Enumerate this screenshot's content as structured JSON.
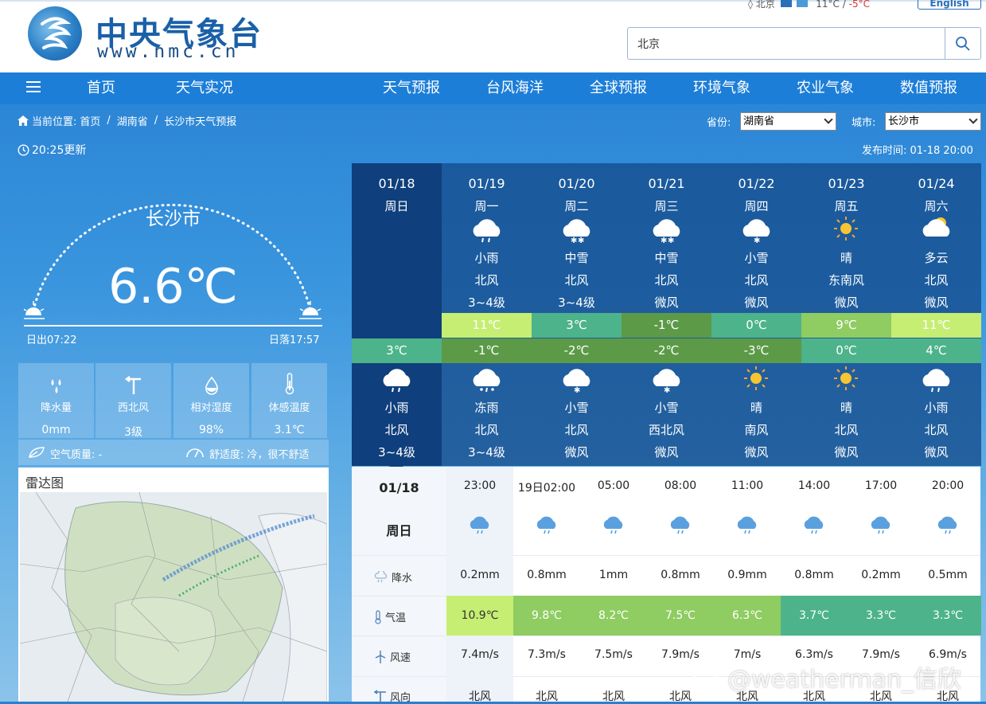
{
  "header": {
    "site_name": "中央气象台",
    "site_url": "www.nmc.cn",
    "topbar_city": "北京",
    "topbar_temp": "11°C",
    "topbar_temp_low": "-5°C",
    "english_label": "English",
    "search_value": "北京"
  },
  "nav": {
    "items": [
      "首页",
      "天气实况",
      "天气预报",
      "台风海洋",
      "全球预报",
      "环境气象",
      "农业气象",
      "数值预报"
    ]
  },
  "breadcrumb": {
    "prefix": "当前位置:",
    "items": [
      "首页",
      "湖南省",
      "长沙市天气预报"
    ]
  },
  "selectors": {
    "province_label": "省份:",
    "province_value": "湖南省",
    "city_label": "城市:",
    "city_value": "长沙市"
  },
  "update_time": "20:25更新",
  "publish_time": "发布时间: 01-18 20:00",
  "current": {
    "city": "长沙市",
    "temp": "6.6℃",
    "sunrise": "日出07:22",
    "sunset": "日落17:57",
    "stats": [
      {
        "label": "降水量",
        "value": "0mm",
        "icon": "raindrops-icon"
      },
      {
        "label": "西北风",
        "value": "3级",
        "icon": "wind-vane-icon"
      },
      {
        "label": "相对湿度",
        "value": "98%",
        "icon": "humidity-drop-icon"
      },
      {
        "label": "体感温度",
        "value": "3.1℃",
        "icon": "thermometer-icon"
      }
    ],
    "air_quality": "空气质量: -",
    "comfort": "舒适度: 冷，很不舒适"
  },
  "radar": {
    "title": "雷达图"
  },
  "forecast": [
    {
      "date": "01/18",
      "week": "周日",
      "day_weather": "",
      "day_wind": "",
      "day_wind_level": "",
      "high": "",
      "low": "3℃",
      "night_weather": "小雨",
      "night_wind": "北风",
      "night_wind_level": "3~4级",
      "day_icon": "",
      "night_icon": "cloud-rain-icon"
    },
    {
      "date": "01/19",
      "week": "周一",
      "day_weather": "小雨",
      "day_wind": "北风",
      "day_wind_level": "3~4级",
      "high": "11℃",
      "low": "-1℃",
      "night_weather": "冻雨",
      "night_wind": "北风",
      "night_wind_level": "3~4级",
      "day_icon": "cloud-rain-icon",
      "night_icon": "freezing-rain-icon"
    },
    {
      "date": "01/20",
      "week": "周二",
      "day_weather": "中雪",
      "day_wind": "北风",
      "day_wind_level": "3~4级",
      "high": "3℃",
      "low": "-2℃",
      "night_weather": "小雪",
      "night_wind": "北风",
      "night_wind_level": "微风",
      "day_icon": "cloud-snow-icon",
      "night_icon": "cloud-light-snow-icon"
    },
    {
      "date": "01/21",
      "week": "周三",
      "day_weather": "中雪",
      "day_wind": "北风",
      "day_wind_level": "微风",
      "high": "-1℃",
      "low": "-2℃",
      "night_weather": "小雪",
      "night_wind": "西北风",
      "night_wind_level": "微风",
      "day_icon": "cloud-snow-icon",
      "night_icon": "cloud-light-snow-icon"
    },
    {
      "date": "01/22",
      "week": "周四",
      "day_weather": "小雪",
      "day_wind": "北风",
      "day_wind_level": "微风",
      "high": "0℃",
      "low": "-3℃",
      "night_weather": "晴",
      "night_wind": "南风",
      "night_wind_level": "微风",
      "day_icon": "cloud-light-snow-icon",
      "night_icon": "sun-icon"
    },
    {
      "date": "01/23",
      "week": "周五",
      "day_weather": "晴",
      "day_wind": "东南风",
      "day_wind_level": "微风",
      "high": "9℃",
      "low": "0℃",
      "night_weather": "晴",
      "night_wind": "北风",
      "night_wind_level": "微风",
      "day_icon": "sun-icon",
      "night_icon": "sun-icon"
    },
    {
      "date": "01/24",
      "week": "周六",
      "day_weather": "多云",
      "day_wind": "北风",
      "day_wind_level": "微风",
      "high": "11℃",
      "low": "4℃",
      "night_weather": "小雨",
      "night_wind": "北风",
      "night_wind_level": "微风",
      "day_icon": "partly-cloudy-icon",
      "night_icon": "cloud-rain-icon"
    }
  ],
  "forecast_colors": {
    "high": [
      "",
      "#c6ee73",
      "#4db38a",
      "#5c9a48",
      "#4db38a",
      "#8fcc62",
      "#c6ee73"
    ],
    "low": [
      "#4db38a",
      "#5c9a48",
      "#5c9a48",
      "#5c9a48",
      "#5c9a48",
      "#4db38a",
      "#4db38a"
    ]
  },
  "hourly": {
    "date": "01/18",
    "week": "周日",
    "labels": {
      "rain": "降水",
      "temp": "气温",
      "wind_speed": "风速",
      "wind_dir": "风向"
    },
    "times": [
      "23:00",
      "19日02:00",
      "05:00",
      "08:00",
      "11:00",
      "14:00",
      "17:00",
      "20:00"
    ],
    "rain": [
      "0.2mm",
      "0.8mm",
      "1mm",
      "0.8mm",
      "0.9mm",
      "0.8mm",
      "0.2mm",
      "0.5mm"
    ],
    "temps": [
      "10.9℃",
      "9.8℃",
      "8.2℃",
      "7.5℃",
      "6.3℃",
      "3.7℃",
      "3.3℃",
      "3.3℃"
    ],
    "temp_colors": [
      "#c6ee73",
      "#8fcc62",
      "#8fcc62",
      "#8fcc62",
      "#8fcc62",
      "#4db38a",
      "#4db38a",
      "#4db38a"
    ],
    "wind_speed": [
      "7.4m/s",
      "7.3m/s",
      "7.5m/s",
      "7.9m/s",
      "7m/s",
      "6.3m/s",
      "7.9m/s",
      "6.9m/s"
    ],
    "wind_dir": [
      "北风",
      "北风",
      "北风",
      "北风",
      "北风",
      "北风",
      "北风",
      "北风"
    ]
  },
  "watermark": "@weatherman_信欣"
}
